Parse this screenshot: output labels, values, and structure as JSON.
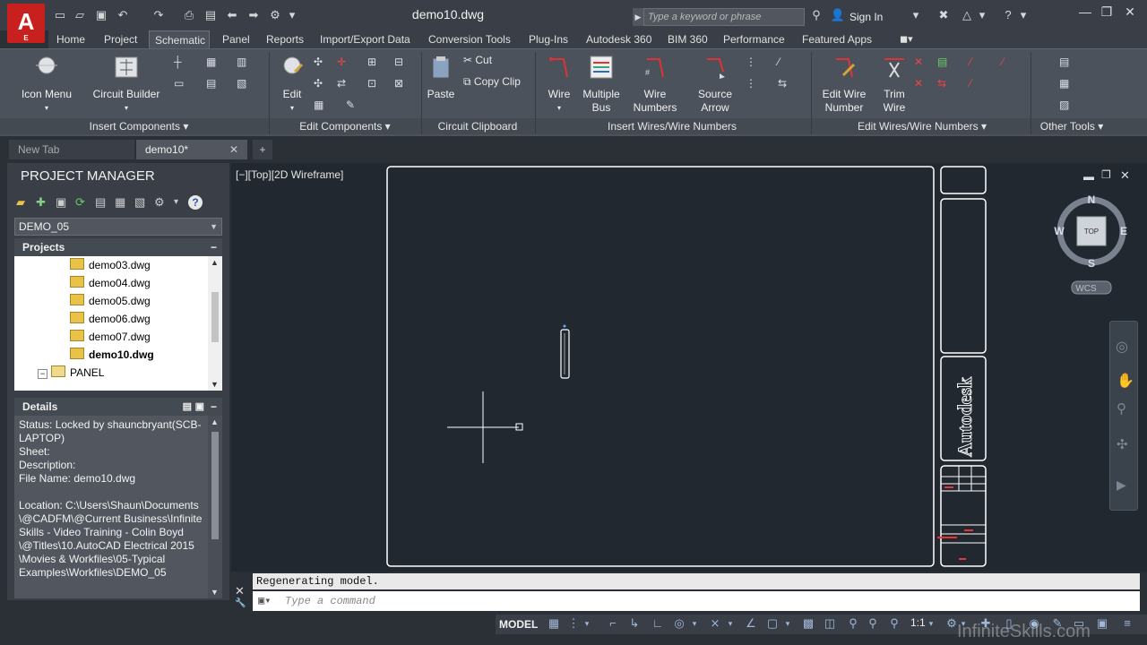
{
  "title_bar": {
    "logo_letter": "A",
    "logo_sub": "E",
    "document_title": "demo10.dwg",
    "search_placeholder": "Type a keyword or phrase",
    "sign_in_label": "Sign In"
  },
  "ribbon_tabs": [
    "Home",
    "Project",
    "Schematic",
    "Panel",
    "Reports",
    "Import/Export Data",
    "Conversion Tools",
    "Plug-Ins",
    "Autodesk 360",
    "BIM 360",
    "Performance",
    "Featured Apps"
  ],
  "active_tab": "Schematic",
  "ribbon": {
    "buttons": {
      "icon_menu": "Icon Menu",
      "circuit_builder": "Circuit Builder",
      "edit": "Edit",
      "paste": "Paste",
      "cut": "Cut",
      "copy_clip": "Copy Clip",
      "wire": "Wire",
      "multiple_bus_1": "Multiple",
      "multiple_bus_2": "Bus",
      "wire_numbers_1": "Wire",
      "wire_numbers_2": "Numbers",
      "source_arrow_1": "Source",
      "source_arrow_2": "Arrow",
      "edit_wire_number_1": "Edit Wire",
      "edit_wire_number_2": "Number",
      "trim_wire_1": "Trim",
      "trim_wire_2": "Wire"
    },
    "panels": {
      "insert_components": "Insert Components",
      "edit_components": "Edit Components",
      "circuit_clipboard": "Circuit Clipboard",
      "insert_wires": "Insert Wires/Wire Numbers",
      "edit_wires": "Edit Wires/Wire Numbers",
      "other_tools": "Other Tools"
    }
  },
  "doc_tabs": {
    "new_tab": "New Tab",
    "current": "demo10*"
  },
  "project_manager": {
    "title": "PROJECT MANAGER",
    "project_name": "DEMO_05",
    "projects_header": "Projects",
    "files": [
      "demo03.dwg",
      "demo04.dwg",
      "demo05.dwg",
      "demo06.dwg",
      "demo07.dwg",
      "demo10.dwg"
    ],
    "active_file": "demo10.dwg",
    "folder": "PANEL",
    "details_header": "Details",
    "details_lines": [
      "Status: Locked by shauncbryant(SCB-",
      "LAPTOP)",
      "Sheet:",
      "Description:",
      "File Name: demo10.dwg",
      "",
      "Location: C:\\Users\\Shaun\\Documents",
      "\\@CADFM\\@Current Business\\Infinite",
      "Skills - Video Training - Colin Boyd",
      "\\@Titles\\10.AutoCAD Electrical 2015",
      "\\Movies & Workfiles\\05-Typical",
      "Examples\\Workfiles\\DEMO_05"
    ]
  },
  "viewport": {
    "label": "[−][Top][2D Wireframe]",
    "title_block_text": "Autodesk",
    "viewcube": {
      "n": "N",
      "s": "S",
      "e": "E",
      "w": "W",
      "face": "TOP",
      "ucs": "WCS"
    }
  },
  "command_line": {
    "history": "Regenerating model.",
    "placeholder": "Type a command"
  },
  "status_bar": {
    "model_label": "MODEL",
    "scale": "1:1"
  },
  "watermark": "InfiniteSkills.com",
  "colors": {
    "canvas_bg": "#212830",
    "ribbon_bg": "#4c525b",
    "accent_red": "#c8201e",
    "drawing_line": "#ffffff"
  }
}
